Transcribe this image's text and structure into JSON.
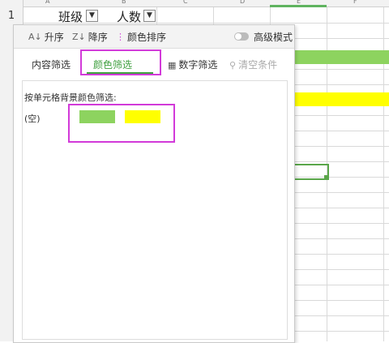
{
  "sheet": {
    "columns": [
      "A",
      "B",
      "C",
      "D",
      "E",
      "F"
    ],
    "row_number": "1",
    "header_cells": [
      "班级",
      "人数"
    ],
    "band_colors": {
      "green": "#8dd35f",
      "yellow": "#ffff00"
    },
    "active_color": "#5aa64a"
  },
  "panel": {
    "toolbar": {
      "sort_asc": "升序",
      "sort_desc": "降序",
      "color_sort": "颜色排序",
      "advanced_mode": "高级模式"
    },
    "tabs": {
      "content_filter": "内容筛选",
      "color_filter": "颜色筛选",
      "number_filter": "数字筛选",
      "clear_filter": "清空条件"
    },
    "color_filter": {
      "label": "按单元格背景颜色筛选:",
      "empty_option": "(空)",
      "swatches": [
        {
          "name": "green",
          "color": "#8dd35f"
        },
        {
          "name": "yellow",
          "color": "#ffff00"
        }
      ]
    },
    "highlight_color": "#d23ad9",
    "accent_color": "#3f9f3f"
  }
}
